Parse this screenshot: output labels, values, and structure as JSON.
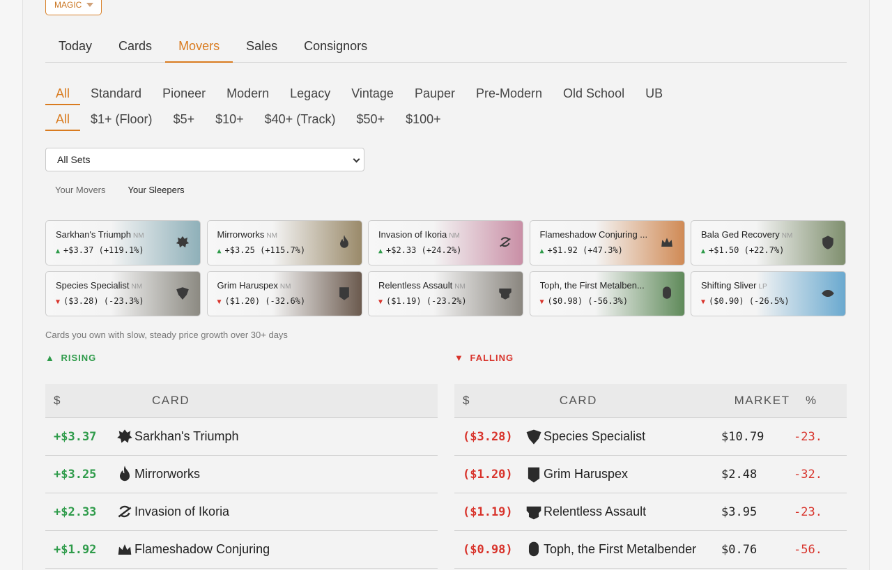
{
  "game_select": {
    "label": "MAGIC"
  },
  "tabs": [
    {
      "label": "Today",
      "active": false
    },
    {
      "label": "Cards",
      "active": false
    },
    {
      "label": "Movers",
      "active": true
    },
    {
      "label": "Sales",
      "active": false
    },
    {
      "label": "Consignors",
      "active": false
    }
  ],
  "formats": [
    "All",
    "Standard",
    "Pioneer",
    "Modern",
    "Legacy",
    "Vintage",
    "Pauper",
    "Pre-Modern",
    "Old School",
    "UB"
  ],
  "price_tiers": [
    "All",
    "$1+ (Floor)",
    "$5+",
    "$10+",
    "$40+ (Track)",
    "$50+",
    "$100+"
  ],
  "set_select": {
    "value": "All Sets"
  },
  "subtabs": {
    "movers": "Your Movers",
    "sleepers": "Your Sleepers"
  },
  "mover_cards": [
    {
      "name": "Sarkhan's Triumph",
      "cond": "NM",
      "dir": "up",
      "delta": "+$3.37 (+119.1%)",
      "tint": "#8fb0b9",
      "icon": "dragon-icon"
    },
    {
      "name": "Mirrorworks",
      "cond": "NM",
      "dir": "up",
      "delta": "+$3.25 (+115.7%)",
      "tint": "#9a8a6a",
      "icon": "flame-icon"
    },
    {
      "name": "Invasion of Ikoria",
      "cond": "NM",
      "dir": "up",
      "delta": "+$2.33 (+24.2%)",
      "tint": "#c98fa6",
      "icon": "planet-icon"
    },
    {
      "name": "Flameshadow Conjuring ...",
      "cond": "",
      "dir": "up",
      "delta": "+$1.92 (+47.3%)",
      "tint": "#d08a55",
      "icon": "crown-icon"
    },
    {
      "name": "Bala Ged Recovery",
      "cond": "NM",
      "dir": "up",
      "delta": "+$1.50 (+22.7%)",
      "tint": "#7f8f6e",
      "icon": "shield-icon"
    },
    {
      "name": "Species Specialist",
      "cond": "NM",
      "dir": "down",
      "delta": "($3.28) (-23.3%)",
      "tint": "#8c8a82",
      "icon": "helm-icon"
    },
    {
      "name": "Grim Haruspex",
      "cond": "NM",
      "dir": "down",
      "delta": "($1.20) (-32.6%)",
      "tint": "#6b5a4e",
      "icon": "banner-icon"
    },
    {
      "name": "Relentless Assault",
      "cond": "NM",
      "dir": "down",
      "delta": "($1.19) (-23.2%)",
      "tint": "#8a867f",
      "icon": "mask-icon"
    },
    {
      "name": "Toph, the First Metalben...",
      "cond": "",
      "dir": "down",
      "delta": "($0.98) (-56.3%)",
      "tint": "#5f8a5a",
      "icon": "fist-icon"
    },
    {
      "name": "Shifting Sliver",
      "cond": "LP",
      "dir": "down",
      "delta": "($0.90) (-26.5%)",
      "tint": "#6aa9cf",
      "icon": "sliver-icon"
    }
  ],
  "note": "Cards you own with slow, steady price growth over 30+ days",
  "rising_label": "RISING",
  "falling_label": "FALLING",
  "rising_table": {
    "headers": {
      "amount": "$",
      "card": "CARD"
    },
    "rows": [
      {
        "amount": "+$3.37",
        "card": "Sarkhan's Triumph",
        "icon": "dragon-icon"
      },
      {
        "amount": "+$3.25",
        "card": "Mirrorworks",
        "icon": "flame-icon"
      },
      {
        "amount": "+$2.33",
        "card": "Invasion of Ikoria",
        "icon": "planet-icon"
      },
      {
        "amount": "+$1.92",
        "card": "Flameshadow Conjuring",
        "icon": "crown-icon"
      }
    ]
  },
  "falling_table": {
    "headers": {
      "amount": "$",
      "card": "CARD",
      "market": "MARKET",
      "pct": "%"
    },
    "rows": [
      {
        "amount": "($3.28)",
        "card": "Species Specialist",
        "market": "$10.79",
        "pct": "-23.",
        "icon": "helm-icon"
      },
      {
        "amount": "($1.20)",
        "card": "Grim Haruspex",
        "market": "$2.48",
        "pct": "-32.",
        "icon": "banner-icon"
      },
      {
        "amount": "($1.19)",
        "card": "Relentless Assault",
        "market": "$3.95",
        "pct": "-23.",
        "icon": "mask-icon"
      },
      {
        "amount": "($0.98)",
        "card": "Toph, the First Metalbender",
        "market": "$0.76",
        "pct": "-56.",
        "icon": "fist-icon"
      }
    ]
  },
  "colors": {
    "accent": "#d97b1f",
    "rising": "#2e9b4a",
    "falling": "#d8342c"
  }
}
